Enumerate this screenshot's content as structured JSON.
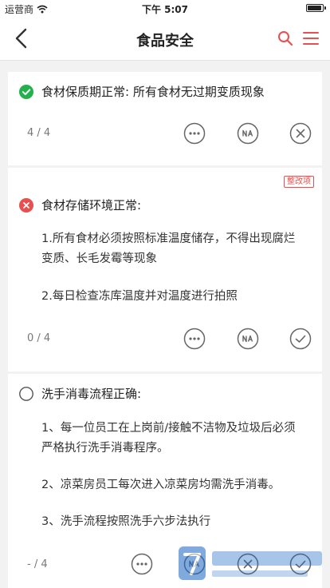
{
  "status_bar": {
    "carrier": "运营商",
    "time": "下午 5:07"
  },
  "header": {
    "title": "食品安全",
    "accent_color": "#e84f4f"
  },
  "items": [
    {
      "status": "pass",
      "status_color": "#22b14c",
      "question": "食材保质期正常: 所有食材无过期变质现象",
      "details": [],
      "count": "4 / 4",
      "actions": [
        "more",
        "na",
        "close"
      ]
    },
    {
      "status": "fail",
      "status_color": "#e84f4f",
      "tag": "整改项",
      "question": "食材存储环境正常:",
      "details": [
        "1.所有食材必须按照标准温度储存，不得出现腐烂变质、长毛发霉等现象",
        "2.每日检查冻库温度并对温度进行拍照"
      ],
      "count": "0 / 4",
      "actions": [
        "more",
        "na",
        "check"
      ]
    },
    {
      "status": "unchecked",
      "question": "洗手消毒流程正确:",
      "details": [
        "1、每一位员工在上岗前/接触不洁物及垃圾后必须严格执行洗手消毒程序。",
        "2、凉菜房员工每次进入凉菜房均需洗手消毒。",
        "3、洗手流程按照洗手六步法执行"
      ],
      "count": "- / 4",
      "actions": [
        "more",
        "na",
        "close",
        "check"
      ]
    }
  ],
  "watermark": {
    "text": "第七下载站",
    "url": "www.d7down.com"
  }
}
